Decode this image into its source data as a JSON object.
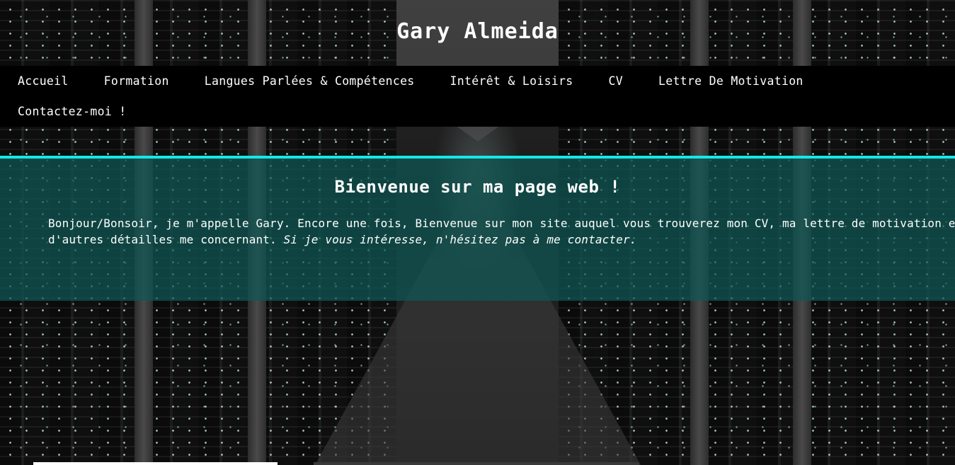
{
  "site": {
    "title": "Gary Almeida"
  },
  "nav": {
    "items": [
      {
        "label": "Accueil"
      },
      {
        "label": "Formation"
      },
      {
        "label": "Langues Parlées & Compétences"
      },
      {
        "label": "Intérêt & Loisirs"
      },
      {
        "label": "CV"
      },
      {
        "label": "Lettre De Motivation"
      },
      {
        "label": "Contactez-moi !"
      }
    ]
  },
  "welcome": {
    "heading": "Bienvenue sur ma page web !",
    "text_plain": "Bonjour/Bonsoir, je m'appelle Gary. Encore une fois, Bienvenue sur mon site auquel vous trouverez mon CV, ma lettre de motivation et d'autres détailles me concernant. ",
    "text_italic": "Si je vous intéresse, n'hésitez pas à me contacter."
  },
  "colors": {
    "accent": "#13e8e8",
    "nav_bg": "#000000",
    "panel_bg": "#0e5854"
  },
  "background": {
    "icon": "server-room-image"
  }
}
